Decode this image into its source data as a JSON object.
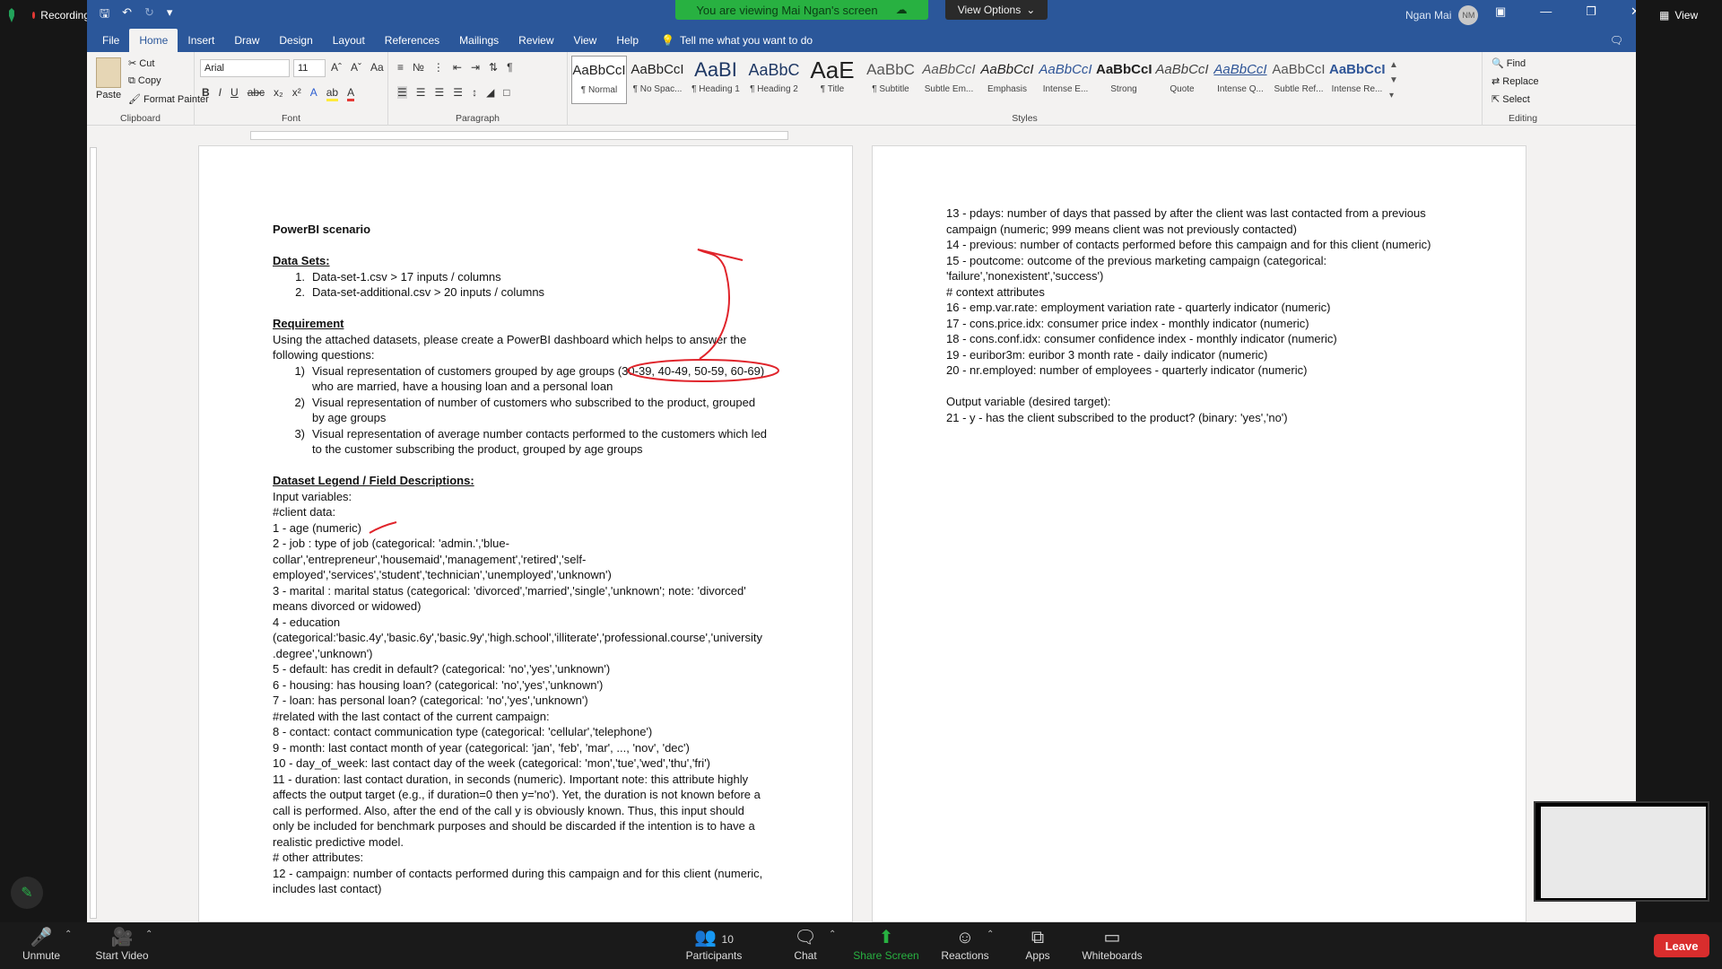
{
  "zoom": {
    "recording_label": "Recording",
    "share_banner": "You are viewing Mai Ngan's screen",
    "view_options": "View Options",
    "view_label": "View",
    "toolbar": [
      {
        "name": "unmute",
        "label": "Unmute",
        "icon": "mic-off-icon"
      },
      {
        "name": "start-video",
        "label": "Start Video",
        "icon": "video-off-icon"
      },
      {
        "name": "participants",
        "label": "Participants",
        "count": "10",
        "icon": "participants-icon"
      },
      {
        "name": "chat",
        "label": "Chat",
        "icon": "chat-icon"
      },
      {
        "name": "share-screen",
        "label": "Share Screen",
        "icon": "share-screen-icon"
      },
      {
        "name": "reactions",
        "label": "Reactions",
        "icon": "reactions-icon"
      },
      {
        "name": "apps",
        "label": "Apps",
        "icon": "apps-icon"
      },
      {
        "name": "whiteboards",
        "label": "Whiteboards",
        "icon": "whiteboard-icon"
      }
    ],
    "leave": "Leave",
    "colors": {
      "banner": "#28b141",
      "leave": "#d92d2d",
      "share": "#28b141"
    }
  },
  "word": {
    "user_name": "Ngan Mai",
    "user_initials": "NM",
    "tabs": [
      "File",
      "Home",
      "Insert",
      "Draw",
      "Design",
      "Layout",
      "References",
      "Mailings",
      "Review",
      "View",
      "Help"
    ],
    "tell_me": "Tell me what you want to do",
    "clipboard": {
      "paste": "Paste",
      "cut": "Cut",
      "copy": "Copy",
      "format_painter": "Format Painter",
      "label": "Clipboard"
    },
    "font": {
      "name": "Arial",
      "size": "11",
      "label": "Font"
    },
    "paragraph_label": "Paragraph",
    "styles_label": "Styles",
    "styles": [
      {
        "preview": "AaBbCcI",
        "name": "¶ Normal"
      },
      {
        "preview": "AaBbCcI",
        "name": "¶ No Spac..."
      },
      {
        "preview": "AaBI",
        "name": "¶ Heading 1"
      },
      {
        "preview": "AaBbC",
        "name": "¶ Heading 2"
      },
      {
        "preview": "AaE",
        "name": "¶ Title"
      },
      {
        "preview": "AaBbC",
        "name": "¶ Subtitle"
      },
      {
        "preview": "AaBbCcI",
        "name": "Subtle Em..."
      },
      {
        "preview": "AaBbCcI",
        "name": "Emphasis"
      },
      {
        "preview": "AaBbCcI",
        "name": "Intense E..."
      },
      {
        "preview": "AaBbCcI",
        "name": "Strong"
      },
      {
        "preview": "AaBbCcI",
        "name": "Quote"
      },
      {
        "preview": "AaBbCcI",
        "name": "Intense Q..."
      },
      {
        "preview": "AaBbCcI",
        "name": "Subtle Ref..."
      },
      {
        "preview": "AaBbCcI",
        "name": "Intense Re..."
      }
    ],
    "editing": {
      "find": "Find",
      "replace": "Replace",
      "select": "Select",
      "label": "Editing"
    }
  },
  "doc": {
    "title": "PowerBI scenario",
    "datasets_heading": "Data Sets:",
    "datasets": [
      {
        "n": "1.",
        "text": "Data-set-1.csv > 17 inputs / columns"
      },
      {
        "n": "2.",
        "text": "Data-set-additional.csv > 20 inputs / columns"
      }
    ],
    "requirement_heading": "Requirement",
    "requirement_intro": [
      "Using the attached datasets, please create a PowerBI dashboard which helps to answer the",
      "following questions:"
    ],
    "questions": [
      {
        "n": "1)",
        "lines": [
          "Visual representation of customers grouped by age groups (30-39, 40-49, 50-59, 60-69)",
          "who are married, have a housing loan and a personal loan"
        ]
      },
      {
        "n": "2)",
        "lines": [
          "Visual representation of number of customers who subscribed to the product, grouped",
          "by age groups"
        ]
      },
      {
        "n": "3)",
        "lines": [
          "Visual representation of average number contacts performed to the customers which led",
          "to the customer subscribing the product, grouped by age groups"
        ]
      }
    ],
    "legend_heading": "Dataset Legend / Field Descriptions:",
    "legend_lines": [
      "Input variables:",
      "#client data:",
      "1 - age (numeric)",
      "2 - job : type of job (categorical: 'admin.','blue-",
      "collar','entrepreneur','housemaid','management','retired','self-",
      "employed','services','student','technician','unemployed','unknown')",
      "3 - marital : marital status (categorical: 'divorced','married','single','unknown'; note: 'divorced'",
      "means divorced or widowed)",
      "4 - education",
      "(categorical:'basic.4y','basic.6y','basic.9y','high.school','illiterate','professional.course','university",
      ".degree','unknown')",
      "5 - default: has credit in default? (categorical: 'no','yes','unknown')",
      "6 - housing: has housing loan? (categorical: 'no','yes','unknown')",
      "7 - loan: has personal loan? (categorical: 'no','yes','unknown')",
      "#related with the last contact of the current campaign:",
      "8 - contact: contact communication type (categorical: 'cellular','telephone')",
      "9 - month: last contact month of year (categorical: 'jan', 'feb', 'mar', ..., 'nov', 'dec')",
      "10 - day_of_week: last contact day of the week (categorical: 'mon','tue','wed','thu','fri')",
      "11 - duration: last contact duration, in seconds (numeric). Important note: this attribute highly",
      "affects the output target (e.g., if duration=0 then y='no'). Yet, the duration is not known before a",
      "call is performed. Also, after the end of the call y is obviously known. Thus, this input should",
      "only be included for benchmark purposes and should be discarded if the intention is to have a",
      "realistic predictive model.",
      "# other attributes:",
      "12 - campaign: number of contacts performed during this campaign and for this client (numeric,",
      "includes last contact)"
    ],
    "page2_lines": [
      "13 - pdays: number of days that passed by after the client was last contacted from a previous",
      "campaign (numeric; 999 means client was not previously contacted)",
      "14 - previous: number of contacts performed before this campaign and for this client (numeric)",
      "15 - poutcome: outcome of the previous marketing campaign (categorical:",
      "'failure','nonexistent','success')",
      "# context attributes",
      "16 - emp.var.rate: employment variation rate - quarterly indicator (numeric)",
      "17 - cons.price.idx: consumer price index - monthly indicator (numeric)",
      "18 - cons.conf.idx: consumer confidence index - monthly indicator (numeric)",
      "19 - euribor3m: euribor 3 month rate - daily indicator (numeric)",
      "20 - nr.employed: number of employees - quarterly indicator (numeric)",
      "",
      "Output variable (desired target):",
      "21 - y - has the client subscribed to the product? (binary: 'yes','no')"
    ]
  }
}
